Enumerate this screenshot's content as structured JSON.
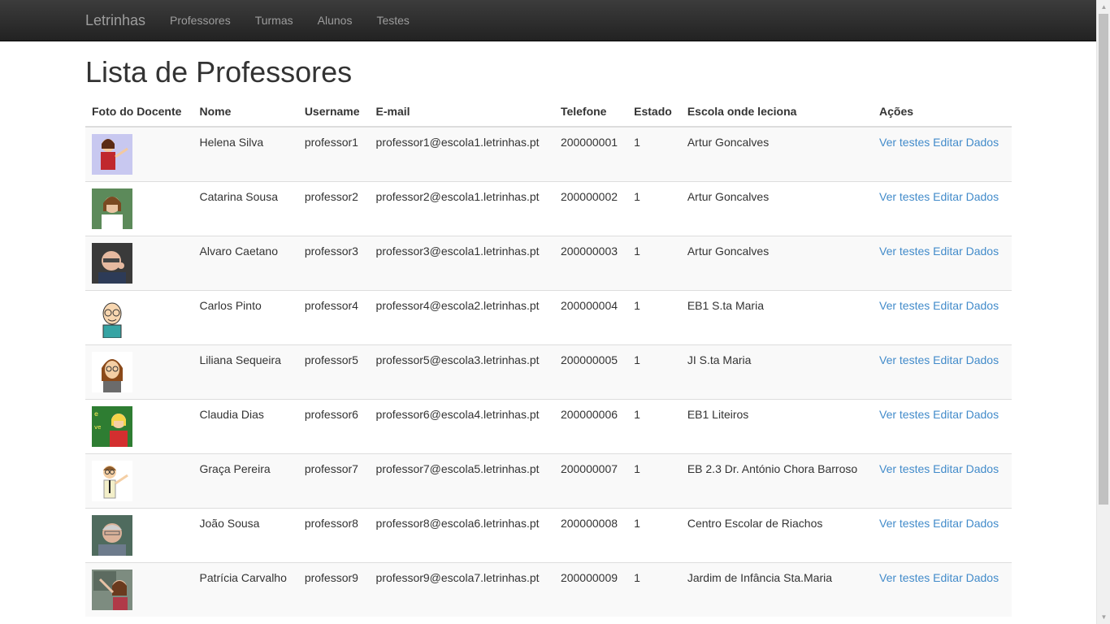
{
  "nav": {
    "brand": "Letrinhas",
    "items": [
      "Professores",
      "Turmas",
      "Alunos",
      "Testes"
    ]
  },
  "page": {
    "title": "Lista de Professores"
  },
  "table": {
    "headers": [
      "Foto do Docente",
      "Nome",
      "Username",
      "E-mail",
      "Telefone",
      "Estado",
      "Escola onde leciona",
      "Ações"
    ],
    "actions": {
      "view_tests": "Ver testes",
      "edit": "Editar Dados"
    },
    "rows": [
      {
        "name": "Helena Silva",
        "username": "professor1",
        "email": "professor1@escola1.letrinhas.pt",
        "phone": "200000001",
        "state": "1",
        "school": "Artur Goncalves",
        "photo": "teacher-cartoon-pointing-icon"
      },
      {
        "name": "Catarina Sousa",
        "username": "professor2",
        "email": "professor2@escola1.letrinhas.pt",
        "phone": "200000002",
        "state": "1",
        "school": "Artur Goncalves",
        "photo": "teacher-photo"
      },
      {
        "name": "Alvaro Caetano",
        "username": "professor3",
        "email": "professor3@escola1.letrinhas.pt",
        "phone": "200000003",
        "state": "1",
        "school": "Artur Goncalves",
        "photo": "teacher-photo"
      },
      {
        "name": "Carlos Pinto",
        "username": "professor4",
        "email": "professor4@escola2.letrinhas.pt",
        "phone": "200000004",
        "state": "1",
        "school": "EB1 S.ta Maria",
        "photo": "teacher-cartoon-icon"
      },
      {
        "name": "Liliana Sequeira",
        "username": "professor5",
        "email": "professor5@escola3.letrinhas.pt",
        "phone": "200000005",
        "state": "1",
        "school": "JI S.ta Maria",
        "photo": "teacher-cartoon-icon"
      },
      {
        "name": "Claudia Dias",
        "username": "professor6",
        "email": "professor6@escola4.letrinhas.pt",
        "phone": "200000006",
        "state": "1",
        "school": "EB1 Liteiros",
        "photo": "teacher-cartoon-chalkboard-icon"
      },
      {
        "name": "Graça Pereira",
        "username": "professor7",
        "email": "professor7@escola5.letrinhas.pt",
        "phone": "200000007",
        "state": "1",
        "school": "EB 2.3 Dr. António Chora Barroso",
        "photo": "teacher-cartoon-icon"
      },
      {
        "name": "João Sousa",
        "username": "professor8",
        "email": "professor8@escola6.letrinhas.pt",
        "phone": "200000008",
        "state": "1",
        "school": "Centro Escolar de Riachos",
        "photo": "teacher-photo"
      },
      {
        "name": "Patrícia Carvalho",
        "username": "professor9",
        "email": "professor9@escola7.letrinhas.pt",
        "phone": "200000009",
        "state": "1",
        "school": "Jardim de Infância Sta.Maria",
        "photo": "teacher-photo"
      }
    ]
  },
  "colors": {
    "navbar": "#222222",
    "link": "#428bca",
    "nav_text": "#9d9d9d"
  }
}
